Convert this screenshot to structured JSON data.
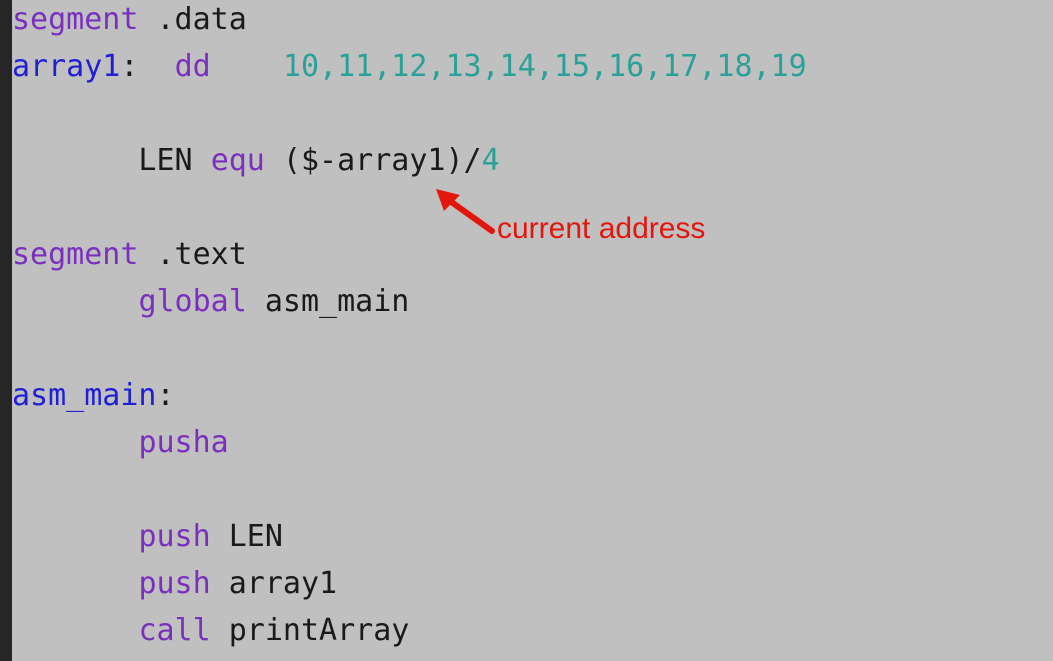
{
  "colors": {
    "keyword": "#7b2fbf",
    "label": "#1f1fd6",
    "number": "#2aa198",
    "plain": "#1a1a1a",
    "annotation": "#e3160e"
  },
  "code": [
    {
      "tokens": [
        {
          "t": "segment",
          "c": "keyword"
        },
        {
          "t": " .data",
          "c": "plain"
        }
      ]
    },
    {
      "tokens": [
        {
          "t": "array1",
          "c": "label"
        },
        {
          "t": ":  ",
          "c": "plain"
        },
        {
          "t": "dd",
          "c": "keyword"
        },
        {
          "t": "    ",
          "c": "plain"
        },
        {
          "t": "10,11,12,13,14,15,16,17,18,19",
          "c": "number"
        }
      ]
    },
    {
      "tokens": []
    },
    {
      "tokens": [
        {
          "t": "       LEN ",
          "c": "plain"
        },
        {
          "t": "equ",
          "c": "keyword"
        },
        {
          "t": " ($-array1)/",
          "c": "plain"
        },
        {
          "t": "4",
          "c": "number"
        }
      ]
    },
    {
      "tokens": []
    },
    {
      "tokens": [
        {
          "t": "segment",
          "c": "keyword"
        },
        {
          "t": " .text",
          "c": "plain"
        }
      ]
    },
    {
      "tokens": [
        {
          "t": "       ",
          "c": "plain"
        },
        {
          "t": "global",
          "c": "keyword"
        },
        {
          "t": " asm_main",
          "c": "plain"
        }
      ]
    },
    {
      "tokens": []
    },
    {
      "tokens": [
        {
          "t": "asm_main",
          "c": "label"
        },
        {
          "t": ":",
          "c": "plain"
        }
      ]
    },
    {
      "tokens": [
        {
          "t": "       ",
          "c": "plain"
        },
        {
          "t": "pusha",
          "c": "keyword"
        }
      ]
    },
    {
      "tokens": []
    },
    {
      "tokens": [
        {
          "t": "       ",
          "c": "plain"
        },
        {
          "t": "push",
          "c": "keyword"
        },
        {
          "t": " LEN",
          "c": "plain"
        }
      ]
    },
    {
      "tokens": [
        {
          "t": "       ",
          "c": "plain"
        },
        {
          "t": "push",
          "c": "keyword"
        },
        {
          "t": " array1",
          "c": "plain"
        }
      ]
    },
    {
      "tokens": [
        {
          "t": "       ",
          "c": "plain"
        },
        {
          "t": "call",
          "c": "keyword"
        },
        {
          "t": " printArray",
          "c": "plain"
        }
      ]
    }
  ],
  "annotation": {
    "text": "current address"
  }
}
